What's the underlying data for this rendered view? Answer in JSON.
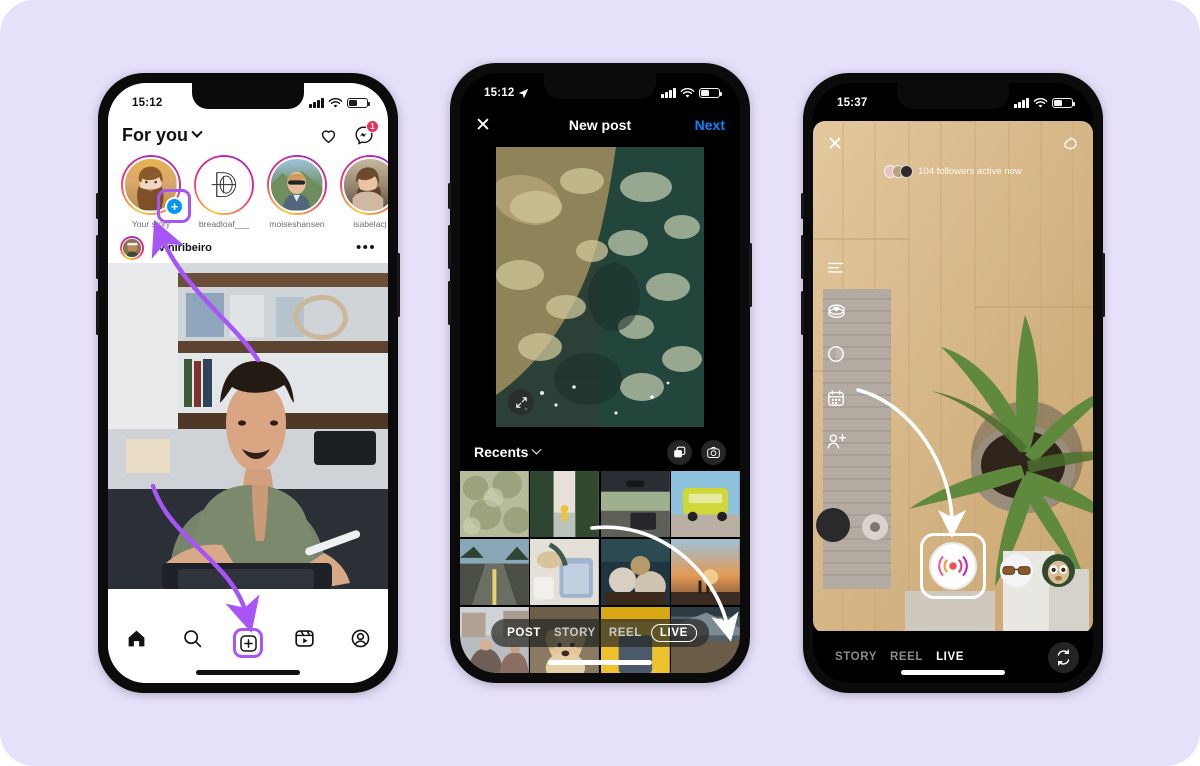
{
  "background": {
    "color": "#e7e0fb"
  },
  "phone1": {
    "name": "instagram-feed",
    "status": {
      "time": "15:12"
    },
    "header": {
      "title": "For you",
      "chevron_icon": "chevron-down-icon",
      "heart_icon": "heart-icon",
      "messenger_icon": "messenger-icon",
      "badge_count": "1"
    },
    "stories": [
      {
        "name": "Your story",
        "has_plus": true,
        "highlighted": true
      },
      {
        "name": "breadloaf___",
        "has_plus": false,
        "highlighted": false
      },
      {
        "name": "moiseshansen",
        "has_plus": false,
        "highlighted": false
      },
      {
        "name": "isabelacj",
        "has_plus": false,
        "highlighted": false
      }
    ],
    "post": {
      "username": "oviniribeiro",
      "more_icon": "ellipsis-icon"
    },
    "tabbar": [
      {
        "name": "home-icon",
        "label": "Home",
        "active": true
      },
      {
        "name": "search-icon",
        "label": "Search",
        "active": false
      },
      {
        "name": "create-icon",
        "label": "Create",
        "active": false,
        "highlighted": true
      },
      {
        "name": "reels-icon",
        "label": "Reels",
        "active": false
      },
      {
        "name": "profile-icon",
        "label": "Profile",
        "active": false
      }
    ]
  },
  "phone2": {
    "name": "new-post-gallery",
    "status": {
      "time": "15:12",
      "location_icon": "location-arrow-icon"
    },
    "header": {
      "close_label": "✕",
      "title": "New post",
      "next_label": "Next"
    },
    "preview": {
      "expand_icon": "expand-icon"
    },
    "gallery": {
      "album_label": "Recents",
      "chevron_icon": "chevron-down-icon",
      "multiselect_icon": "multi-select-icon",
      "camera_icon": "camera-icon"
    },
    "modes": [
      {
        "label": "POST",
        "active": true,
        "ringed": false
      },
      {
        "label": "STORY",
        "active": false,
        "ringed": false
      },
      {
        "label": "REEL",
        "active": false,
        "ringed": false
      },
      {
        "label": "LIVE",
        "active": false,
        "ringed": true
      }
    ]
  },
  "phone3": {
    "name": "instagram-live-camera",
    "status": {
      "time": "15:37",
      "recording_dot": true
    },
    "camera": {
      "close_label": "✕",
      "settings_icon": "gear-icon",
      "active_now_text": "104 followers active now"
    },
    "tools": [
      {
        "name": "title-icon"
      },
      {
        "name": "sticker-icon"
      },
      {
        "name": "brightness-icon"
      },
      {
        "name": "calendar-icon"
      },
      {
        "name": "add-people-icon"
      }
    ],
    "live_button": {
      "name": "go-live-button",
      "highlighted": true
    },
    "modes": [
      {
        "label": "STORY",
        "active": false
      },
      {
        "label": "REEL",
        "active": false
      },
      {
        "label": "LIVE",
        "active": true
      }
    ],
    "flip_icon": "camera-flip-icon"
  },
  "annotations": {
    "arrow_color": "#a855f7",
    "white_arrow_color": "#ffffff"
  }
}
